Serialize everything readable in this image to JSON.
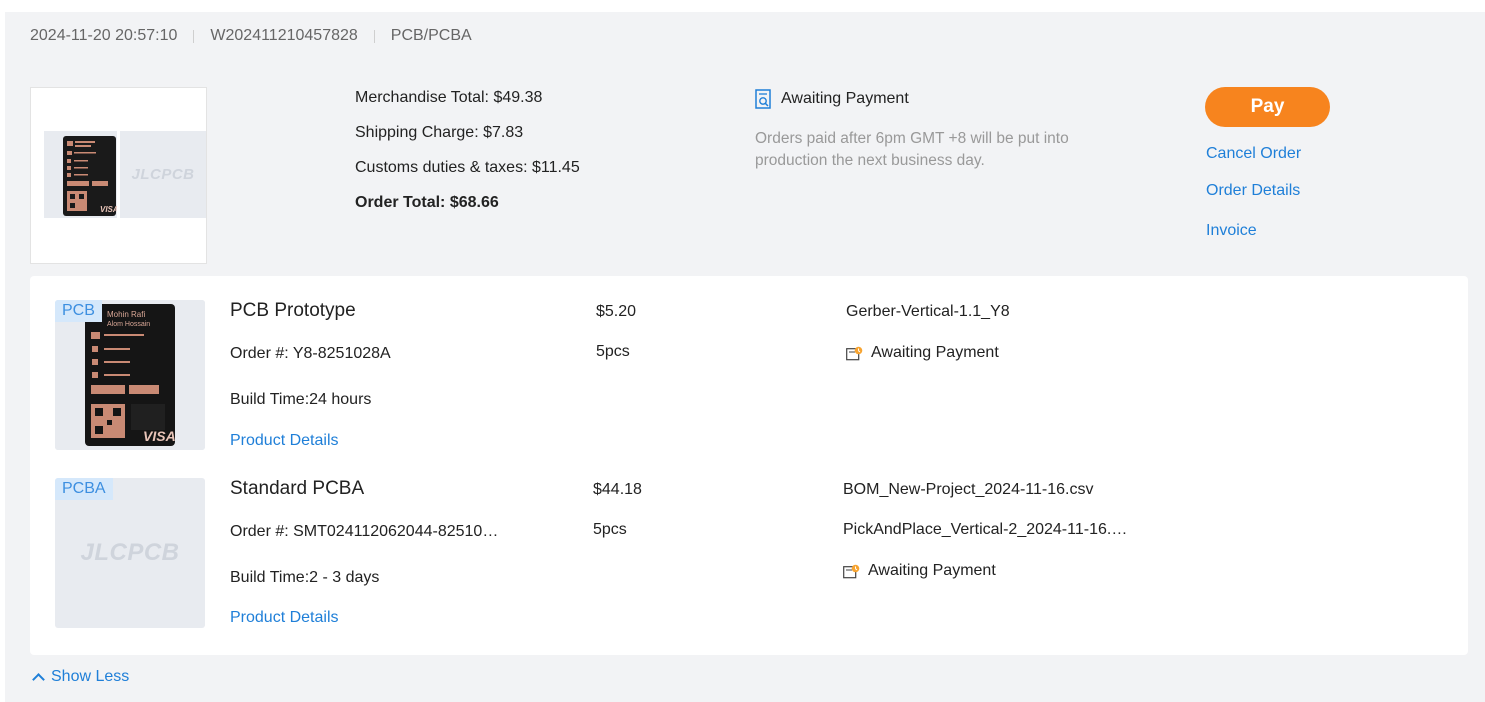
{
  "header": {
    "date": "2024-11-20 20:57:10",
    "order_no": "W202411210457828",
    "type": "PCB/PCBA"
  },
  "thumbs": {
    "logo": "JLCPCB"
  },
  "totals": {
    "merchandise": "Merchandise Total: $49.38",
    "shipping": "Shipping Charge: $7.83",
    "customs": "Customs duties & taxes: $11.45",
    "order_total": "Order Total: $68.66"
  },
  "status": {
    "label": "Awaiting Payment",
    "note": "Orders paid after 6pm GMT +8 will be put into production the next business day."
  },
  "actions": {
    "pay": "Pay",
    "cancel": "Cancel Order",
    "details": "Order Details",
    "invoice": "Invoice"
  },
  "items": [
    {
      "tag": "PCB",
      "title": "PCB Prototype",
      "order": "Order #: Y8-8251028A",
      "build": "Build Time:24 hours",
      "price": "$5.20",
      "qty": "5pcs",
      "file1": "Gerber-Vertical-1.1_Y8",
      "status": "Awaiting Payment",
      "details_link": "Product Details"
    },
    {
      "tag": "PCBA",
      "title": "Standard PCBA",
      "order": "Order #: SMT024112062044-82510…",
      "build": "Build Time:2 - 3 days",
      "price": "$44.18",
      "qty": "5pcs",
      "file1": "BOM_New-Project_2024-11-16.csv",
      "file2": "PickAndPlace_Vertical-2_2024-11-16.…",
      "status": "Awaiting Payment",
      "details_link": "Product Details",
      "logo": "JLCPCB"
    }
  ],
  "show_less": "Show Less",
  "colors": {
    "accent": "#f7841e",
    "link": "#1f7fd8",
    "card_bg": "#f2f3f5"
  }
}
